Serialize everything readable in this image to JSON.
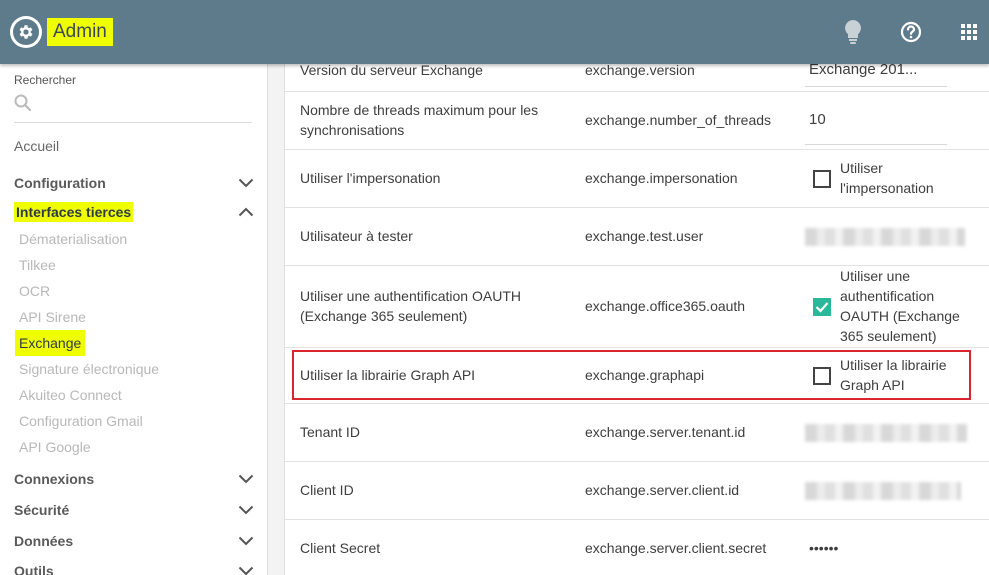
{
  "header": {
    "title": "Admin",
    "logo_icon": "gear-icon",
    "icons": [
      "lightbulb-icon",
      "help-icon",
      "apps-grid-icon"
    ],
    "bg_color": "#5e7b8b",
    "highlight_color": "#f0ff00"
  },
  "sidebar": {
    "search_label": "Rechercher",
    "home": "Accueil",
    "sections": [
      {
        "label": "Configuration",
        "expanded": false
      },
      {
        "label": "Interfaces tierces",
        "expanded": true
      },
      {
        "label": "Connexions",
        "expanded": false
      },
      {
        "label": "Sécurité",
        "expanded": false
      },
      {
        "label": "Données",
        "expanded": false
      },
      {
        "label": "Outils",
        "expanded": false
      }
    ],
    "sub_items": [
      "Dématerialisation",
      "Tilkee",
      "OCR",
      "API Sirene",
      "Exchange",
      "Signature électronique",
      "Akuiteo Connect",
      "Configuration Gmail",
      "API Google"
    ],
    "active_sub_item": "Exchange"
  },
  "table": {
    "rows": [
      {
        "label": "Version du serveur Exchange",
        "key": "exchange.version",
        "value": "Exchange 201..."
      },
      {
        "label": "Nombre de threads maximum pour les synchronisations",
        "key": "exchange.number_of_threads",
        "value": "10"
      },
      {
        "label": "Utiliser l'impersonation",
        "key": "exchange.impersonation",
        "checkbox_label": "Utiliser l'impersonation",
        "checked": false
      },
      {
        "label": "Utilisateur à tester",
        "key": "exchange.test.user"
      },
      {
        "label": "Utiliser une authentification OAUTH (Exchange 365 seulement)",
        "key": "exchange.office365.oauth",
        "checkbox_label": "Utiliser une authentification OAUTH (Exchange 365 seulement)",
        "checked": true
      },
      {
        "label": "Utiliser la librairie Graph API",
        "key": "exchange.graphapi",
        "checkbox_label": "Utiliser la librairie Graph API",
        "checked": false
      },
      {
        "label": "Tenant ID",
        "key": "exchange.server.tenant.id"
      },
      {
        "label": "Client ID",
        "key": "exchange.server.client.id"
      },
      {
        "label": "Client Secret",
        "key": "exchange.server.client.secret",
        "value": "••••••"
      }
    ]
  }
}
